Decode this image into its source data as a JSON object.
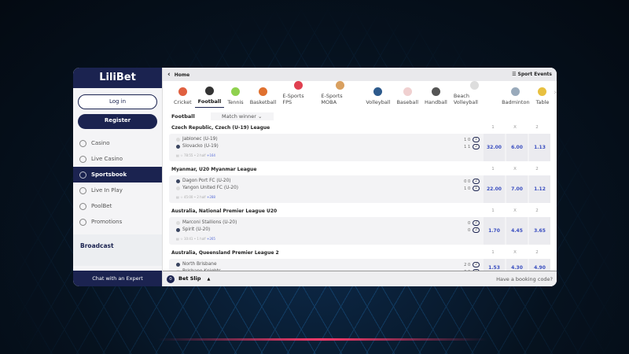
{
  "sidebar": {
    "logo": "LiliBet",
    "login": "Log in",
    "register": "Register",
    "items": [
      {
        "label": "Casino"
      },
      {
        "label": "Live Casino"
      },
      {
        "label": "Sportsbook",
        "active": true
      },
      {
        "label": "Live In Play"
      },
      {
        "label": "PoolBet"
      },
      {
        "label": "Promotions"
      }
    ],
    "broadcast": "Broadcast",
    "chat": "Chat with an Expert"
  },
  "topbar": {
    "back": "‹",
    "home": "Home",
    "sport_events": "Sport Events"
  },
  "tabs": [
    {
      "label": "Cricket",
      "color": "#e06040"
    },
    {
      "label": "Football",
      "color": "#333",
      "active": true
    },
    {
      "label": "Tennis",
      "color": "#8fd14f"
    },
    {
      "label": "Basketball",
      "color": "#e0712f"
    },
    {
      "label": "E-Sports FPS",
      "color": "#e04050"
    },
    {
      "label": "E-Sports MOBA",
      "color": "#d9a060"
    },
    {
      "label": "Volleyball",
      "color": "#2d5a8c"
    },
    {
      "label": "Baseball",
      "color": "#f0d0d0"
    },
    {
      "label": "Handball",
      "color": "#555"
    },
    {
      "label": "Beach Volleyball",
      "color": "#ddd"
    },
    {
      "label": "Badminton",
      "color": "#9ab"
    },
    {
      "label": "Table",
      "color": "#e8c040"
    }
  ],
  "filter": {
    "sport": "Football",
    "market": "Match winner ⌄"
  },
  "col_headers": [
    "1",
    "X",
    "2"
  ],
  "leagues": [
    {
      "name": "Czech Republic, Czech (U-19) League",
      "home": "Jablonec (U-19)",
      "away": "Slovacko (U-19)",
      "home_score": "1 0",
      "away_score": "1 1",
      "home_badge": "1",
      "away_badge": "2",
      "meta": "78:55 • 2 half",
      "more": "+164",
      "odds": [
        "32.00",
        "6.00",
        "1.13"
      ]
    },
    {
      "name": "Myanmar, U20 Myanmar League",
      "home": "Dagon Port FC (U-20)",
      "away": "Yangon United FC (U-20)",
      "home_score": "0 0",
      "away_score": "1 0",
      "home_badge": "2",
      "away_badge": "1",
      "meta": "45:00 • 2 half",
      "more": "+288",
      "odds": [
        "22.00",
        "7.00",
        "1.12"
      ]
    },
    {
      "name": "Australia, National Premier League U20",
      "home": "Marconi Stallions (U-20)",
      "away": "Spirit (U-20)",
      "home_score": "0",
      "away_score": "0",
      "home_badge": "2",
      "away_badge": "2",
      "meta": "10:41 • 1 half",
      "more": "+265",
      "odds": [
        "1.70",
        "4.45",
        "3.65"
      ]
    },
    {
      "name": "Australia, Queensland Premier League 2",
      "home": "North Brisbane",
      "away": "Brisbane Knights",
      "home_score": "2 0",
      "away_score": "0 0",
      "home_badge": "2",
      "away_badge": "1",
      "meta": "",
      "more": "",
      "odds": [
        "1.53",
        "4.30",
        "4.90"
      ]
    }
  ],
  "betslip": {
    "count": "0",
    "label": "Bet Slip",
    "booking": "Have a booking code?"
  }
}
